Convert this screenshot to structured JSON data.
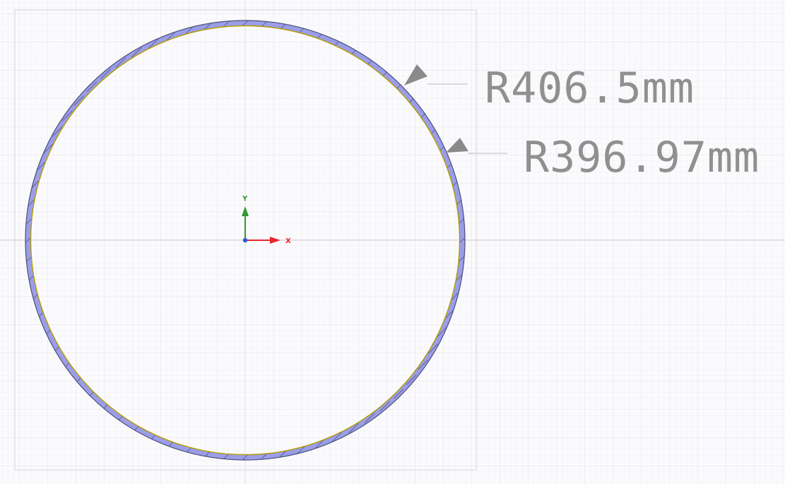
{
  "dimensions": [
    {
      "label": "R406.5mm"
    },
    {
      "label": "R396.97mm"
    }
  ],
  "axes": {
    "x_label": "X",
    "y_label": "Y",
    "x_color": "#e8262b",
    "y_color": "#2e9a2e",
    "origin_color": "#2a5bd7"
  },
  "colors": {
    "background": "#fbfbfd",
    "grid_minor": "#e7e7ef",
    "grid_major": "#d9d9e3",
    "ring_fill": "#9a9ee8",
    "ring_outline": "#4d4f7a",
    "inner_edge": "#b59c00",
    "leader": "#b8b8c0",
    "arrow": "#8a8a8a",
    "dim_text": "#909090"
  }
}
